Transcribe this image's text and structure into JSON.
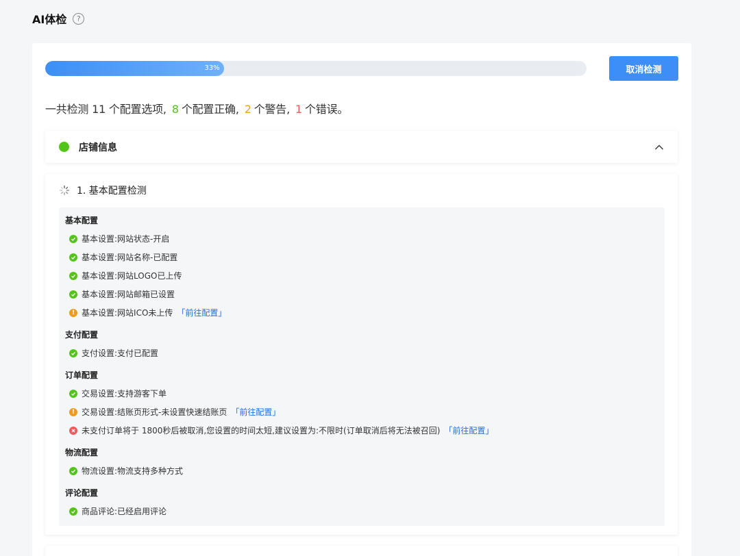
{
  "header": {
    "title": "AI体检",
    "help_glyph": "?"
  },
  "progress": {
    "value": 0.33,
    "label": "33%",
    "color_start": "#3d8ff5",
    "color_end": "#6fb0fb"
  },
  "cancel_button": {
    "label": "取消检测",
    "color": "#3e8ef7"
  },
  "summary": {
    "prefix": "一共检测 11 个配置选项,",
    "ok_count": "8",
    "ok_text": "个配置正确,",
    "warn_count": "2",
    "warn_text": "个警告,",
    "err_count": "1",
    "err_text": "个错误。",
    "colors": {
      "ok": "#52c41a",
      "warn": "#f0a020",
      "err": "#f25a5a"
    }
  },
  "section": {
    "title": "店铺信息",
    "status_color": "#52c41a",
    "expanded": true
  },
  "check": {
    "title": "1. 基本配置检测",
    "groups": [
      {
        "title": "基本配置",
        "items": [
          {
            "status": "ok",
            "text": "基本设置:网站状态-开启"
          },
          {
            "status": "ok",
            "text": "基本设置:网站名称-已配置"
          },
          {
            "status": "ok",
            "text": "基本设置:网站LOGO已上传"
          },
          {
            "status": "ok",
            "text": "基本设置:网站邮箱已设置"
          },
          {
            "status": "warn",
            "text": "基本设置:网站ICO未上传",
            "link": "「前往配置」"
          }
        ]
      },
      {
        "title": "支付配置",
        "items": [
          {
            "status": "ok",
            "text": "支付设置:支付已配置"
          }
        ]
      },
      {
        "title": "订单配置",
        "items": [
          {
            "status": "ok",
            "text": "交易设置:支持游客下单"
          },
          {
            "status": "warn",
            "text": "交易设置:结账页形式-未设置快速结账页",
            "link": "「前往配置」"
          },
          {
            "status": "err",
            "text": "未支付订单将于 1800秒后被取消,您设置的时间太短,建议设置为:不限时(订单取消后将无法被召回)",
            "link": "「前往配置」"
          }
        ]
      },
      {
        "title": "物流配置",
        "items": [
          {
            "status": "ok",
            "text": "物流设置:物流支持多种方式"
          }
        ]
      },
      {
        "title": "评论配置",
        "items": [
          {
            "status": "ok",
            "text": "商品评论:已经启用评论"
          }
        ]
      }
    ]
  }
}
